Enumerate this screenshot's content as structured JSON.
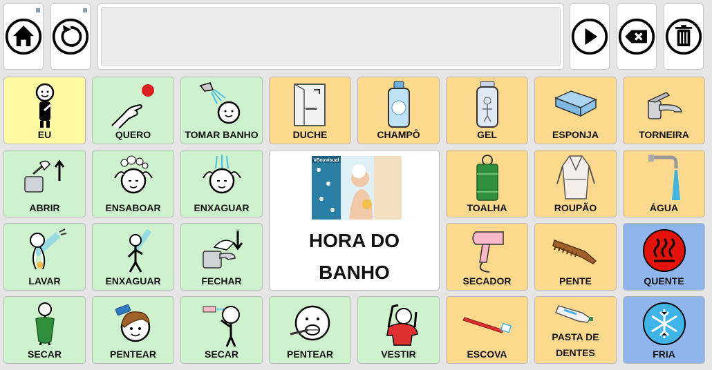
{
  "toolbar": {
    "home_icon": "home-icon",
    "undo_icon": "undo-icon",
    "play_icon": "play-icon",
    "backspace_icon": "backspace-icon",
    "trash_icon": "trash-icon"
  },
  "message_bar": {
    "text": ""
  },
  "colors": {
    "yellow": "#fcf9a2",
    "green": "#cdf2cd",
    "orange": "#fdd98d",
    "blue": "#8fb6ec"
  },
  "cells": {
    "eu": "EU",
    "quero": "QUERO",
    "tomar_banho": "TOMAR BANHO",
    "duche": "DUCHE",
    "champo": "CHAMPÔ",
    "gel": "GEL",
    "esponja": "ESPONJA",
    "torneira": "TORNEIRA",
    "abrir": "ABRIR",
    "ensaboar": "ENSABOAR",
    "enxaguar_1": "ENXAGUAR",
    "toalha": "TOALHA",
    "roupao": "ROUPÃO",
    "agua": "ÁGUA",
    "lavar": "LAVAR",
    "enxaguar_2": "ENXAGUAR",
    "fechar": "FECHAR",
    "secador": "SECADOR",
    "pente": "PENTE",
    "quente": "QUENTE",
    "secar_1": "SECAR",
    "pentear_1": "PENTEAR",
    "secar_2": "SECAR",
    "pentear_2": "PENTEAR",
    "vestir": "VESTIR",
    "escova": "ESCOVA",
    "pasta_de_dentes": "PASTA DE DENTES",
    "fria": "FRIA"
  },
  "center": {
    "title": "HORA DO\nBANHO",
    "photo_tag": "#Soyvisual"
  }
}
